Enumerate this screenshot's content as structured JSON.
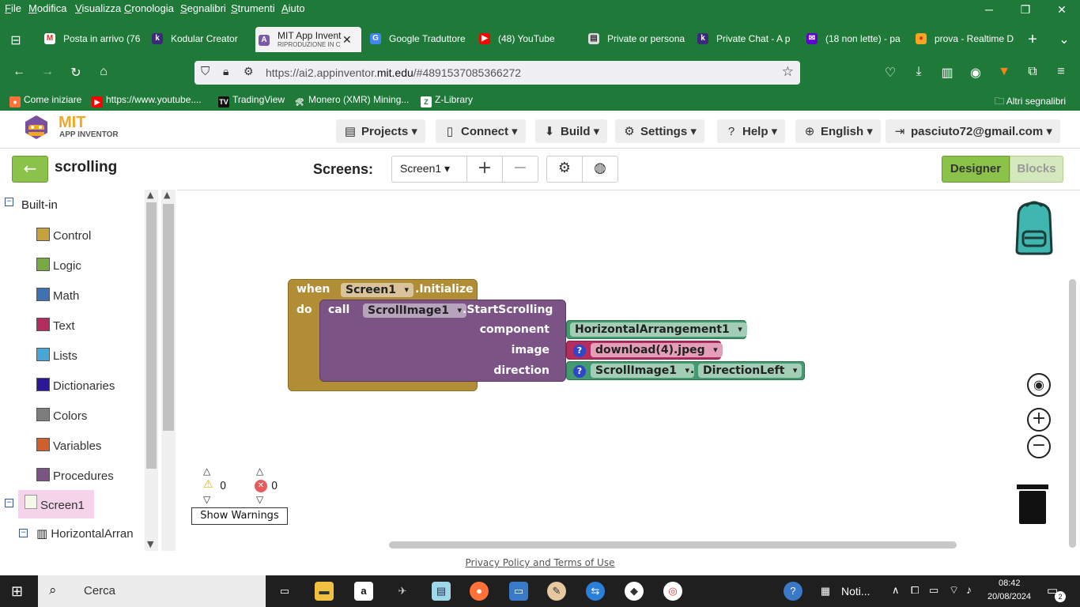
{
  "menubar": {
    "items": [
      "File",
      "Modifica",
      "Visualizza",
      "Cronologia",
      "Segnalibri",
      "Strumenti",
      "Aiuto"
    ]
  },
  "tabs": [
    {
      "title": "Posta in arrivo (76",
      "icon": "gmail-icon"
    },
    {
      "title": "Kodular Creator",
      "icon": "kodular-icon"
    },
    {
      "title": "MIT App Invent",
      "subtitle": "RIPRODUZIONE IN C",
      "icon": "appinventor-icon",
      "active": true
    },
    {
      "title": "Google Traduttore",
      "icon": "google-translate-icon"
    },
    {
      "title": "(48) YouTube",
      "icon": "youtube-icon"
    },
    {
      "title": "Private or persona",
      "icon": "page-icon"
    },
    {
      "title": "Private Chat - A p",
      "icon": "kodular-icon"
    },
    {
      "title": "(18 non lette) - pa",
      "icon": "mail-icon"
    },
    {
      "title": "prova - Realtime D",
      "icon": "firebase-icon"
    }
  ],
  "url": {
    "prefix": "https://ai2.appinventor.",
    "domain": "mit.edu",
    "suffix": "/#4891537085366272"
  },
  "bookmarks": [
    {
      "label": "Come iniziare",
      "icon": "firefox-icon"
    },
    {
      "label": "https://www.youtube....",
      "icon": "youtube-icon"
    },
    {
      "label": "TradingView",
      "icon": "tradingview-icon"
    },
    {
      "label": "Monero (XMR) Mining...",
      "icon": "monero-icon"
    },
    {
      "label": "Z-Library",
      "icon": "zlibrary-icon"
    }
  ],
  "other_bookmarks": "Altri segnalibri",
  "app": {
    "logo_line1": "MIT",
    "logo_line2": "APP INVENTOR",
    "menu": {
      "projects": "Projects",
      "connect": "Connect",
      "build": "Build",
      "settings": "Settings",
      "help": "Help",
      "language": "English",
      "account": "pasciuto72@gmail.com"
    },
    "project_name": "scrolling",
    "screens_label": "Screens:",
    "screen_selected": "Screen1",
    "designer": "Designer",
    "blocks": "Blocks"
  },
  "palette": {
    "builtin": "Built-in",
    "items": [
      {
        "label": "Control",
        "color": "#c8a13c"
      },
      {
        "label": "Logic",
        "color": "#77ab41"
      },
      {
        "label": "Math",
        "color": "#3f71b5"
      },
      {
        "label": "Text",
        "color": "#b32d5e"
      },
      {
        "label": "Lists",
        "color": "#49a6d4"
      },
      {
        "label": "Dictionaries",
        "color": "#2d1799"
      },
      {
        "label": "Colors",
        "color": "#7d7d7d"
      },
      {
        "label": "Variables",
        "color": "#d05f2d"
      },
      {
        "label": "Procedures",
        "color": "#7c5385"
      }
    ],
    "screen": "Screen1",
    "component": "HorizontalArran"
  },
  "blocks": {
    "when": "when",
    "event_component": "Screen1",
    "event_name": ".Initialize",
    "do": "do",
    "call": "call",
    "method_component": "ScrollImage1",
    "method_name": ".StartScrolling",
    "arg1": "component",
    "arg2": "image",
    "arg3": "direction",
    "val1": "HorizontalArrangement1",
    "val2": "download(4).jpeg",
    "val3_component": "ScrollImage1",
    "val3_dot": ".",
    "val3_prop": "DirectionLeft",
    "colors": {
      "event": "#b18e35",
      "method": "#7c5385",
      "component": "#439970",
      "text": "#b32d5e"
    }
  },
  "warnings": {
    "warn_count": "0",
    "error_count": "0",
    "show_label": "Show Warnings"
  },
  "footer": "Privacy Policy and Terms of Use",
  "taskbar": {
    "search": "Cerca",
    "noti": "Noti...",
    "time": "08:42",
    "date": "20/08/2024",
    "notif_count": "2"
  }
}
